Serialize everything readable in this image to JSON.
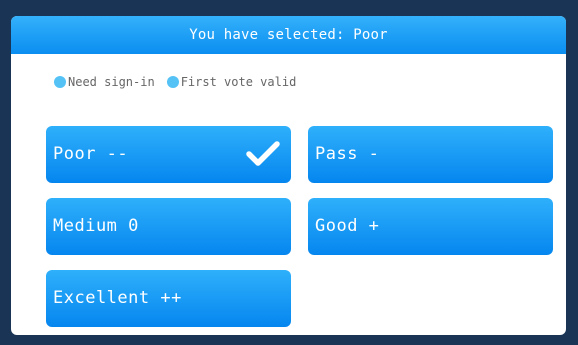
{
  "header": {
    "title": "You have selected: Poor"
  },
  "info": {
    "items": [
      {
        "label": "Need sign-in"
      },
      {
        "label": "First vote valid"
      }
    ]
  },
  "options": [
    {
      "label": "Poor --",
      "selected": true
    },
    {
      "label": "Pass -"
    },
    {
      "label": "Medium 0"
    },
    {
      "label": "Good +"
    },
    {
      "label": "Excellent ++"
    }
  ],
  "colors": {
    "accent": "#0a8ef0",
    "dot": "#55c2f6",
    "frame": "#1a3456"
  },
  "icons": {
    "selected_indicator": "checkmark-icon",
    "info_bullet": "dot-icon"
  }
}
